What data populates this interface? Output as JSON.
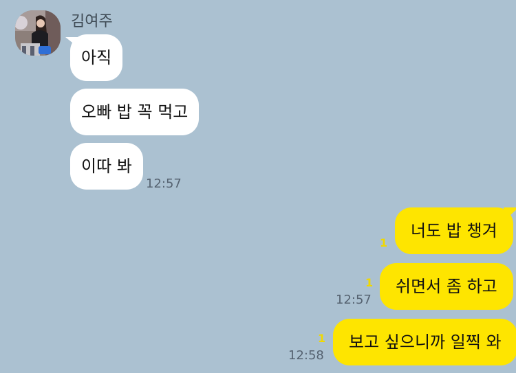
{
  "sender": {
    "name": "김여주",
    "avatar_icon": "profile-photo"
  },
  "incoming": [
    {
      "text": "아직"
    },
    {
      "text": "오빠 밥 꼭 먹고"
    },
    {
      "text": "이따 봐",
      "time": "12:57"
    }
  ],
  "outgoing": [
    {
      "text": "너도 밥 챙겨",
      "unread": "1"
    },
    {
      "text": "쉬면서 좀 하고",
      "unread": "1",
      "time": "12:57"
    },
    {
      "text": "보고 싶으니까 일찍 와",
      "unread": "1",
      "time": "12:58"
    }
  ],
  "colors": {
    "background": "#abc1d1",
    "incoming_bubble": "#ffffff",
    "outgoing_bubble": "#fee500",
    "unread_count": "#f0d800"
  }
}
